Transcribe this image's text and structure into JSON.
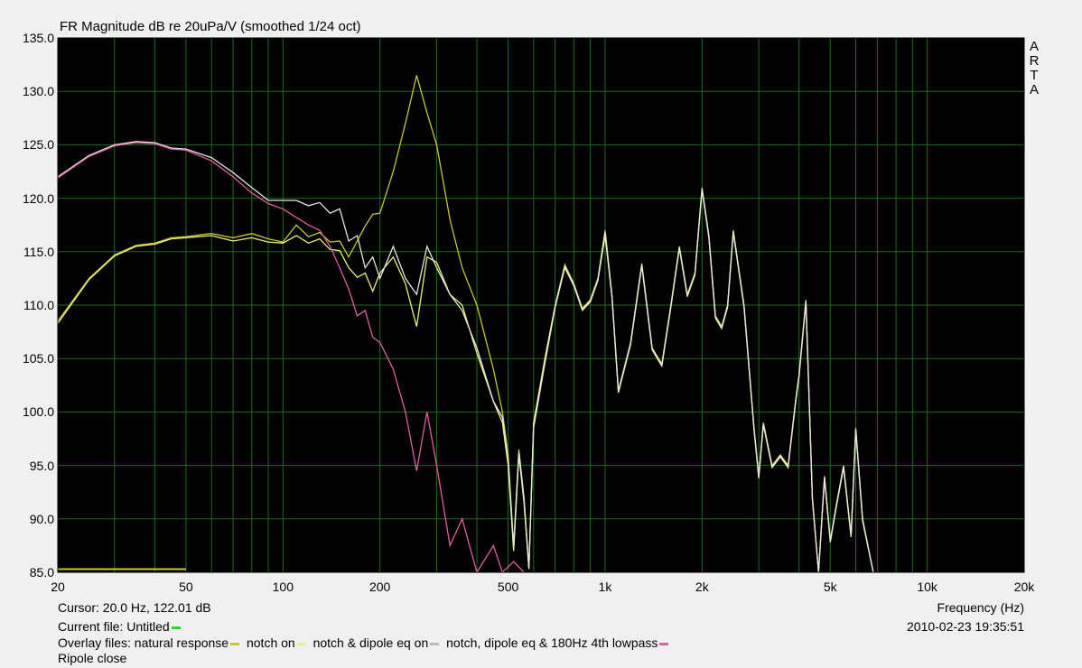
{
  "chart_data": {
    "type": "line",
    "title": "FR Magnitude dB re 20uPa/V (smoothed 1/24 oct)",
    "xlabel": "Frequency (Hz)",
    "ylabel": "",
    "xscale": "log",
    "xlim": [
      20,
      20000
    ],
    "ylim": [
      85,
      135
    ],
    "yticks": [
      "135.0",
      "130.0",
      "125.0",
      "120.0",
      "115.0",
      "110.0",
      "105.0",
      "100.0",
      "95.0",
      "90.0",
      "85.0"
    ],
    "xticks": [
      {
        "v": 20,
        "label": "20"
      },
      {
        "v": 50,
        "label": "50"
      },
      {
        "v": 100,
        "label": "100"
      },
      {
        "v": 200,
        "label": "200"
      },
      {
        "v": 500,
        "label": "500"
      },
      {
        "v": 1000,
        "label": "1k"
      },
      {
        "v": 2000,
        "label": "2k"
      },
      {
        "v": 5000,
        "label": "5k"
      },
      {
        "v": 10000,
        "label": "10k"
      },
      {
        "v": 20000,
        "label": "20k"
      }
    ],
    "grid": true,
    "background": "#000000",
    "grid_color": "#1f6b1f",
    "series": [
      {
        "name": "natural response",
        "color": "#c8c832",
        "points": [
          [
            20,
            108.5
          ],
          [
            25,
            112.5
          ],
          [
            30,
            114.7
          ],
          [
            35,
            115.6
          ],
          [
            40,
            115.8
          ],
          [
            45,
            116.3
          ],
          [
            50,
            116.4
          ],
          [
            60,
            116.7
          ],
          [
            70,
            116.3
          ],
          [
            80,
            116.7
          ],
          [
            90,
            116.2
          ],
          [
            100,
            115.9
          ],
          [
            110,
            117.5
          ],
          [
            120,
            116.4
          ],
          [
            130,
            116.8
          ],
          [
            140,
            115.9
          ],
          [
            150,
            116.0
          ],
          [
            160,
            114.5
          ],
          [
            170,
            116.0
          ],
          [
            180,
            117.4
          ],
          [
            190,
            118.5
          ],
          [
            200,
            118.6
          ],
          [
            220,
            122.5
          ],
          [
            240,
            127.0
          ],
          [
            260,
            131.5
          ],
          [
            280,
            128.0
          ],
          [
            300,
            125.0
          ],
          [
            330,
            118.0
          ],
          [
            360,
            113.5
          ],
          [
            400,
            110.0
          ],
          [
            450,
            104.0
          ],
          [
            480,
            100.0
          ],
          [
            500,
            96.0
          ],
          [
            520,
            87.5
          ],
          [
            540,
            96.5
          ],
          [
            560,
            92.0
          ],
          [
            580,
            85.5
          ],
          [
            600,
            99.0
          ],
          [
            650,
            105.0
          ],
          [
            700,
            110.0
          ],
          [
            750,
            113.8
          ],
          [
            800,
            112.0
          ],
          [
            850,
            109.7
          ],
          [
            900,
            110.5
          ],
          [
            950,
            112.5
          ],
          [
            1000,
            117.0
          ],
          [
            1050,
            111.0
          ],
          [
            1100,
            102.0
          ],
          [
            1200,
            106.5
          ],
          [
            1300,
            113.9
          ],
          [
            1400,
            106.0
          ],
          [
            1500,
            104.5
          ],
          [
            1600,
            110.0
          ],
          [
            1700,
            115.5
          ],
          [
            1800,
            111.0
          ],
          [
            1900,
            113.0
          ],
          [
            2000,
            121.0
          ],
          [
            2100,
            116.5
          ],
          [
            2200,
            109.0
          ],
          [
            2300,
            108.0
          ],
          [
            2400,
            110.0
          ],
          [
            2500,
            117.0
          ],
          [
            2700,
            110.0
          ],
          [
            2900,
            98.5
          ],
          [
            3000,
            94.0
          ],
          [
            3100,
            99.0
          ],
          [
            3300,
            95.0
          ],
          [
            3500,
            96.0
          ],
          [
            3700,
            95.0
          ],
          [
            3900,
            101.0
          ],
          [
            4000,
            103.5
          ],
          [
            4200,
            110.5
          ],
          [
            4400,
            92.0
          ],
          [
            4600,
            85.0
          ],
          [
            4800,
            94.0
          ],
          [
            5000,
            88.0
          ],
          [
            5200,
            91.0
          ],
          [
            5500,
            95.0
          ],
          [
            5800,
            88.5
          ],
          [
            6000,
            98.5
          ],
          [
            6300,
            90.0
          ],
          [
            6800,
            85.0
          ]
        ]
      },
      {
        "name": "notch on",
        "color": "#f0f078",
        "points": [
          [
            20,
            108.3
          ],
          [
            25,
            112.4
          ],
          [
            30,
            114.6
          ],
          [
            35,
            115.5
          ],
          [
            40,
            115.7
          ],
          [
            45,
            116.2
          ],
          [
            50,
            116.3
          ],
          [
            60,
            116.5
          ],
          [
            70,
            116.0
          ],
          [
            80,
            116.3
          ],
          [
            90,
            115.9
          ],
          [
            100,
            115.8
          ],
          [
            110,
            116.5
          ],
          [
            120,
            115.8
          ],
          [
            130,
            116.2
          ],
          [
            140,
            115.2
          ],
          [
            150,
            115.1
          ],
          [
            160,
            113.5
          ],
          [
            170,
            112.6
          ],
          [
            180,
            113.0
          ],
          [
            190,
            111.3
          ],
          [
            200,
            113.0
          ],
          [
            220,
            114.5
          ],
          [
            240,
            112.0
          ],
          [
            260,
            108.0
          ],
          [
            280,
            114.5
          ],
          [
            300,
            114.0
          ],
          [
            330,
            111.0
          ],
          [
            360,
            110.0
          ],
          [
            400,
            105.5
          ],
          [
            450,
            101.0
          ],
          [
            480,
            99.0
          ],
          [
            500,
            95.0
          ],
          [
            520,
            87.0
          ],
          [
            540,
            96.0
          ],
          [
            560,
            91.5
          ],
          [
            580,
            85.3
          ],
          [
            600,
            98.5
          ],
          [
            650,
            104.5
          ],
          [
            700,
            109.8
          ],
          [
            750,
            113.5
          ],
          [
            800,
            111.8
          ],
          [
            850,
            109.5
          ],
          [
            900,
            110.3
          ],
          [
            950,
            112.3
          ],
          [
            1000,
            116.5
          ],
          [
            1050,
            110.8
          ],
          [
            1100,
            101.8
          ],
          [
            1200,
            106.3
          ],
          [
            1300,
            113.7
          ],
          [
            1400,
            105.8
          ],
          [
            1500,
            104.3
          ],
          [
            1600,
            109.8
          ],
          [
            1700,
            115.3
          ],
          [
            1800,
            110.8
          ],
          [
            1900,
            112.8
          ],
          [
            2000,
            120.8
          ],
          [
            2100,
            116.3
          ],
          [
            2200,
            108.8
          ],
          [
            2300,
            107.8
          ],
          [
            2400,
            109.8
          ],
          [
            2500,
            116.8
          ],
          [
            2700,
            109.8
          ],
          [
            2900,
            98.3
          ],
          [
            3000,
            93.8
          ],
          [
            3100,
            98.8
          ],
          [
            3300,
            94.8
          ],
          [
            3500,
            95.8
          ],
          [
            3700,
            94.8
          ],
          [
            3900,
            100.8
          ],
          [
            4000,
            103.3
          ],
          [
            4200,
            110.3
          ],
          [
            4400,
            91.8
          ],
          [
            4600,
            85.0
          ],
          [
            4800,
            93.8
          ],
          [
            5000,
            87.8
          ],
          [
            5200,
            90.8
          ],
          [
            5500,
            94.8
          ],
          [
            5800,
            88.3
          ],
          [
            6000,
            98.3
          ],
          [
            6300,
            89.8
          ],
          [
            6800,
            85.0
          ]
        ]
      },
      {
        "name": "notch & dipole eq on",
        "color": "#e6e6e6",
        "points": [
          [
            20,
            122.0
          ],
          [
            25,
            124.0
          ],
          [
            30,
            125.0
          ],
          [
            35,
            125.3
          ],
          [
            40,
            125.2
          ],
          [
            45,
            124.7
          ],
          [
            50,
            124.6
          ],
          [
            60,
            123.8
          ],
          [
            70,
            122.4
          ],
          [
            80,
            121.0
          ],
          [
            90,
            119.8
          ],
          [
            100,
            119.8
          ],
          [
            110,
            119.8
          ],
          [
            120,
            119.3
          ],
          [
            130,
            119.6
          ],
          [
            140,
            118.6
          ],
          [
            150,
            119.0
          ],
          [
            160,
            116.0
          ],
          [
            170,
            116.5
          ],
          [
            180,
            113.5
          ],
          [
            190,
            114.5
          ],
          [
            200,
            112.5
          ],
          [
            220,
            115.5
          ],
          [
            240,
            112.5
          ],
          [
            260,
            111.0
          ],
          [
            280,
            115.5
          ],
          [
            300,
            113.5
          ],
          [
            330,
            111.0
          ],
          [
            360,
            109.5
          ],
          [
            400,
            106.0
          ],
          [
            450,
            101.0
          ],
          [
            480,
            99.5
          ],
          [
            500,
            95.3
          ],
          [
            520,
            87.2
          ],
          [
            540,
            96.2
          ],
          [
            560,
            91.8
          ],
          [
            580,
            85.4
          ],
          [
            600,
            98.8
          ],
          [
            650,
            104.8
          ],
          [
            700,
            109.9
          ],
          [
            750,
            113.6
          ],
          [
            800,
            111.9
          ],
          [
            850,
            109.6
          ],
          [
            900,
            110.4
          ],
          [
            950,
            112.4
          ],
          [
            1000,
            116.8
          ],
          [
            1050,
            110.9
          ],
          [
            1100,
            101.9
          ],
          [
            1200,
            106.4
          ],
          [
            1300,
            113.8
          ],
          [
            1400,
            105.9
          ],
          [
            1500,
            104.4
          ],
          [
            1600,
            109.9
          ],
          [
            1700,
            115.4
          ],
          [
            1800,
            110.9
          ],
          [
            1900,
            112.9
          ],
          [
            2000,
            120.9
          ],
          [
            2100,
            116.4
          ],
          [
            2200,
            108.9
          ],
          [
            2300,
            107.9
          ],
          [
            2400,
            109.9
          ],
          [
            2500,
            116.9
          ],
          [
            2700,
            109.9
          ],
          [
            2900,
            98.4
          ],
          [
            3000,
            93.9
          ],
          [
            3100,
            98.9
          ],
          [
            3300,
            94.9
          ],
          [
            3500,
            95.9
          ],
          [
            3700,
            94.9
          ],
          [
            3900,
            100.9
          ],
          [
            4000,
            103.4
          ],
          [
            4200,
            110.4
          ],
          [
            4400,
            91.9
          ],
          [
            4600,
            85.0
          ],
          [
            4800,
            93.9
          ],
          [
            5000,
            87.9
          ],
          [
            5200,
            90.9
          ],
          [
            5500,
            94.9
          ],
          [
            5800,
            88.4
          ],
          [
            6000,
            98.4
          ],
          [
            6300,
            89.9
          ],
          [
            6800,
            85.0
          ]
        ]
      },
      {
        "name": "notch, dipole eq & 180Hz 4th lowpass",
        "color": "#e060a0",
        "points": [
          [
            20,
            121.9
          ],
          [
            25,
            123.9
          ],
          [
            30,
            124.9
          ],
          [
            35,
            125.2
          ],
          [
            40,
            125.1
          ],
          [
            45,
            124.6
          ],
          [
            50,
            124.5
          ],
          [
            60,
            123.5
          ],
          [
            70,
            122.0
          ],
          [
            80,
            120.5
          ],
          [
            90,
            119.5
          ],
          [
            100,
            119.0
          ],
          [
            110,
            118.2
          ],
          [
            120,
            117.5
          ],
          [
            130,
            117.0
          ],
          [
            140,
            115.5
          ],
          [
            150,
            113.5
          ],
          [
            160,
            111.5
          ],
          [
            170,
            109.0
          ],
          [
            180,
            109.5
          ],
          [
            190,
            107.0
          ],
          [
            200,
            106.5
          ],
          [
            220,
            104.0
          ],
          [
            240,
            100.0
          ],
          [
            260,
            94.5
          ],
          [
            280,
            100.0
          ],
          [
            300,
            95.0
          ],
          [
            330,
            87.5
          ],
          [
            360,
            90.0
          ],
          [
            400,
            85.0
          ],
          [
            450,
            87.5
          ],
          [
            480,
            85.0
          ],
          [
            520,
            86.0
          ],
          [
            560,
            85.0
          ]
        ]
      }
    ]
  },
  "marker": {
    "label_band": [
      20,
      50
    ],
    "value": 85.3
  },
  "arta_label": [
    "A",
    "R",
    "T",
    "A"
  ],
  "cursor_text": "Cursor: 20.0 Hz, 122.01 dB",
  "current_file_label": "Current file: Untitled",
  "current_file_color": "#22dd22",
  "overlay_label": "Overlay files: natural response",
  "overlay_items": [
    {
      "label": "notch on",
      "color": "#c8c832"
    },
    {
      "label": "notch & dipole eq on",
      "color": "#f0f078"
    },
    {
      "label": "notch, dipole eq & 180Hz 4th lowpass",
      "color": "#bbbbbb"
    }
  ],
  "overlay_last_color": "#e060a0",
  "footer_note": "Ripole close",
  "timestamp": "2010-02-23  19:35:51"
}
